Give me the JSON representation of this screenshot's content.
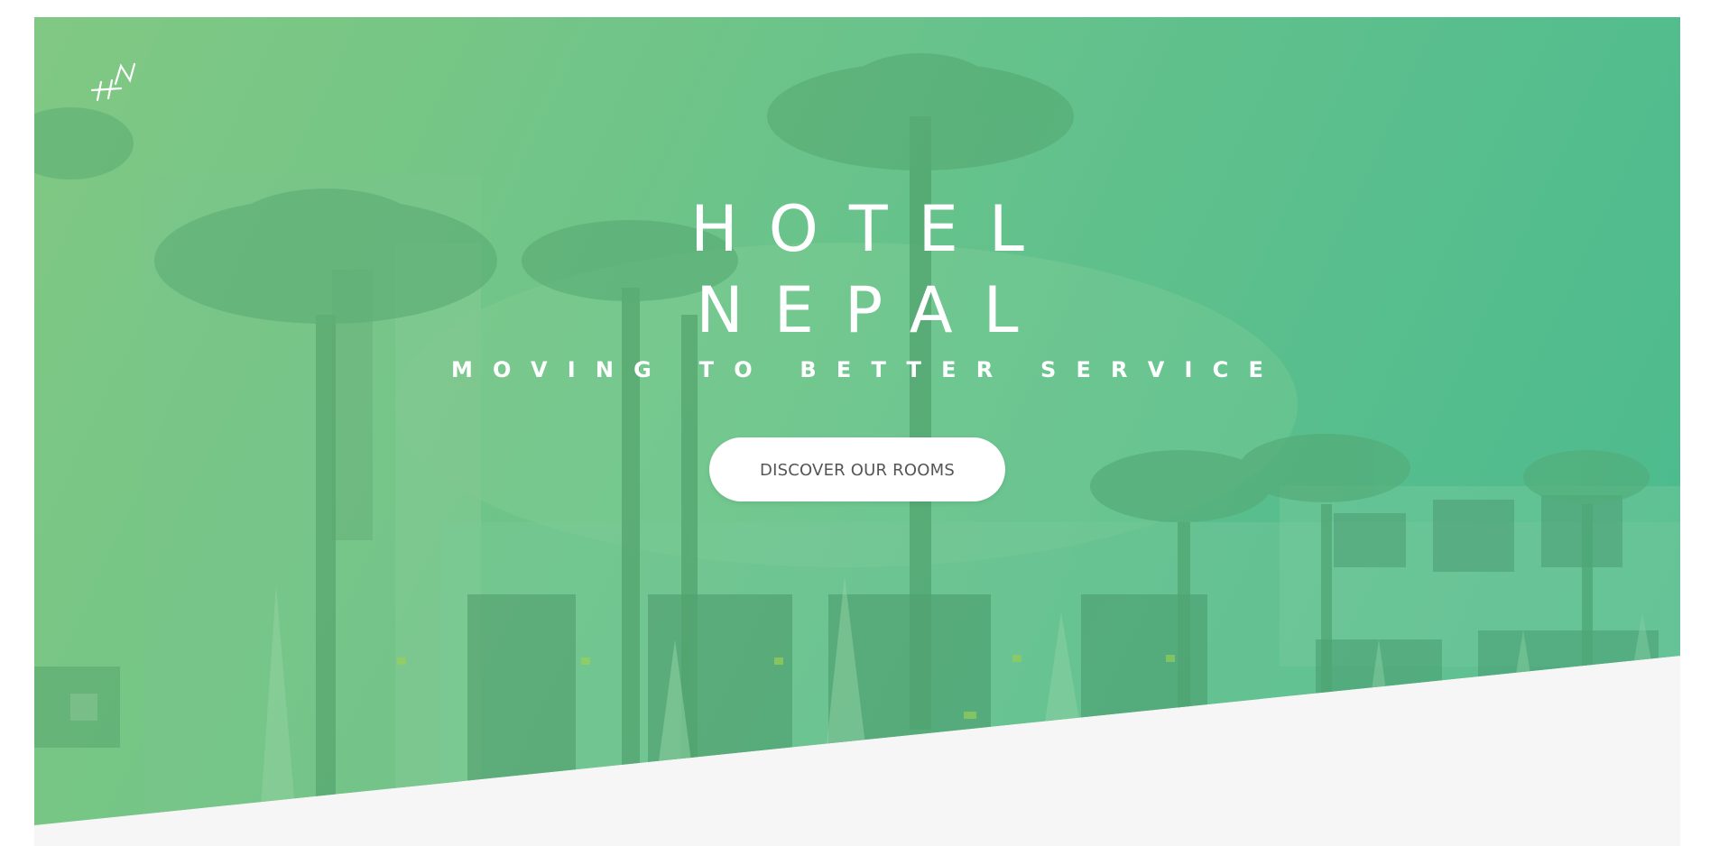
{
  "hero": {
    "title_line_1": "HOTEL",
    "title_line_2": "NEPAL",
    "subtitle": "MOVING TO BETTER SERVICE",
    "cta_label": "DISCOVER OUR ROOMS"
  },
  "logo": {
    "text": "HN",
    "icon": "hotel-nepal-monogram-icon"
  },
  "colors": {
    "overlay_start": "#82c883",
    "overlay_end": "#4dbb8e",
    "section_bg": "#f6f6f6",
    "button_bg": "#ffffff",
    "button_text": "#555555"
  }
}
